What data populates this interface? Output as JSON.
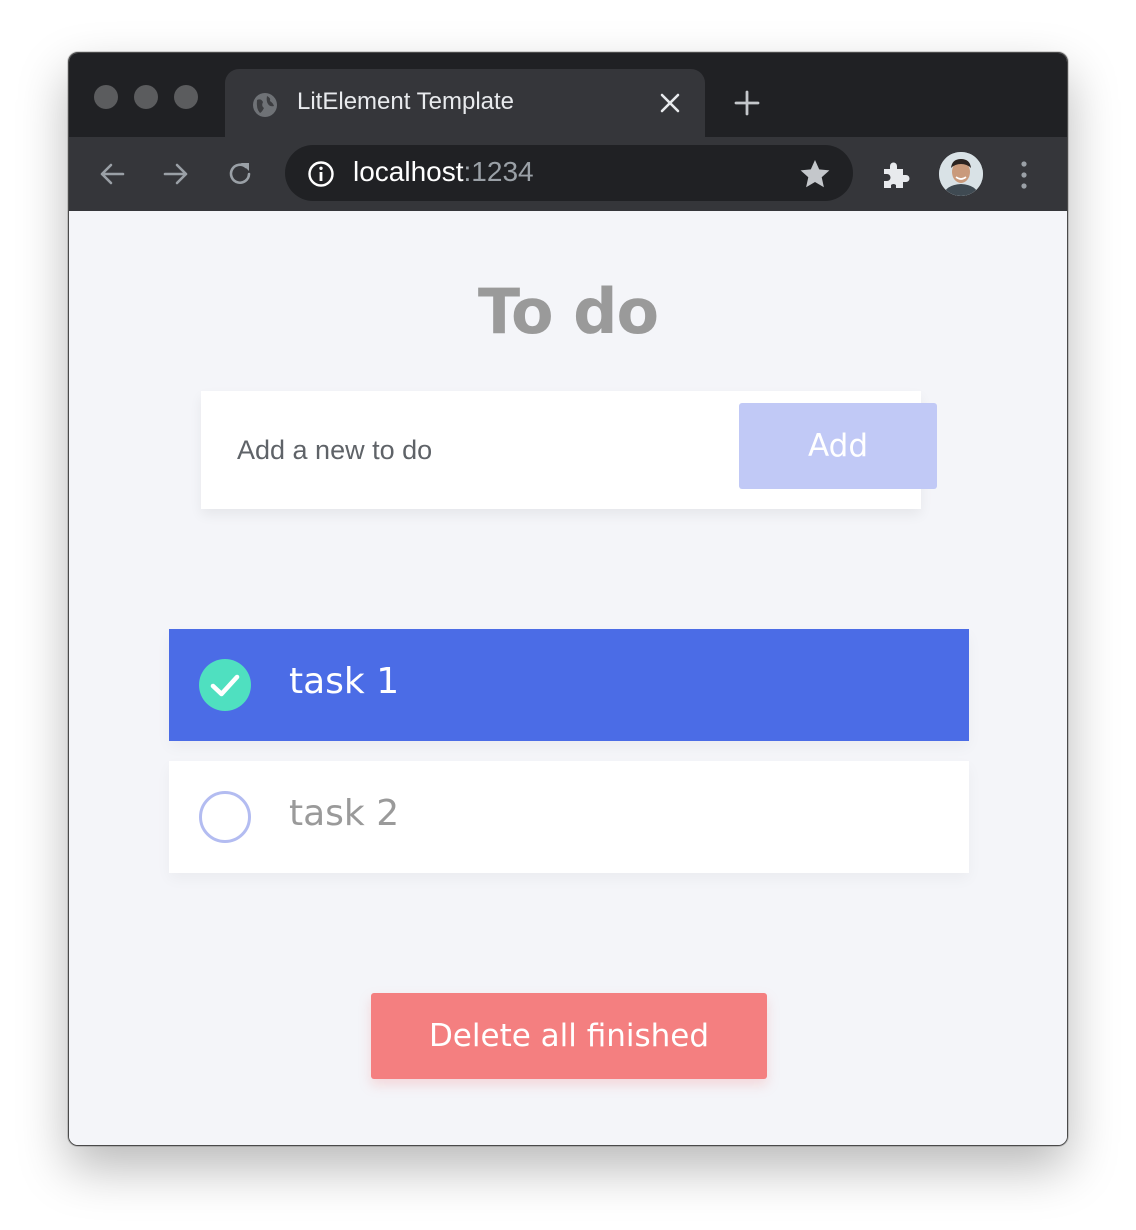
{
  "browser": {
    "tab_title": "LitElement Template",
    "url_host": "localhost",
    "url_port": ":1234"
  },
  "app": {
    "heading": "To do",
    "input_placeholder": "Add a new to do",
    "add_label": "Add",
    "tasks": [
      {
        "label": "task 1",
        "done": true
      },
      {
        "label": "task 2",
        "done": false
      }
    ],
    "delete_label": "Delete all finished"
  },
  "colors": {
    "accent": "#4b6ce6",
    "check": "#4fe0c0",
    "add_button": "#c1c9f6",
    "delete_button": "#f47f80",
    "heading": "#9a9a9a"
  }
}
